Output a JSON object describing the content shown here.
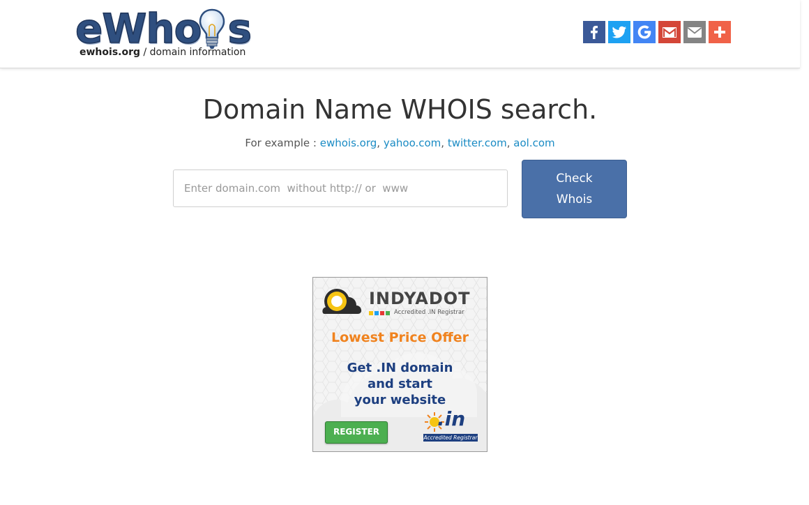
{
  "header": {
    "logo": {
      "main_text": "eWho",
      "main_text_tail": "s",
      "tag_bold": "ewhois.org",
      "tag_rest": " / domain information"
    },
    "share": [
      {
        "name": "facebook",
        "icon": "facebook-icon",
        "color": "#3b5998"
      },
      {
        "name": "twitter",
        "icon": "twitter-icon",
        "color": "#1da1f2"
      },
      {
        "name": "google",
        "icon": "google-icon",
        "color": "#4285f4"
      },
      {
        "name": "gmail",
        "icon": "gmail-icon",
        "color": "#d44638"
      },
      {
        "name": "email",
        "icon": "email-icon",
        "color": "#848484"
      },
      {
        "name": "more",
        "icon": "plus-icon",
        "color": "#f06248"
      }
    ]
  },
  "main": {
    "title": "Domain Name WHOIS search.",
    "examples_label": "For example : ",
    "examples": [
      "ewhois.org",
      "yahoo.com",
      "twitter.com",
      "aol.com"
    ],
    "search": {
      "placeholder": "Enter domain.com  without http:// or  www",
      "value": ""
    },
    "button_line1": "Check",
    "button_line2": "Whois"
  },
  "ad": {
    "brand": "INDYADOT",
    "brand_sub": "Accredited .IN Registrar",
    "headline": "Lowest Price Offer",
    "line1": "Get .IN domain",
    "line2": "and start",
    "line3": "your website",
    "register": "REGISTER",
    "badge_main": ".in",
    "badge_sub": "Accredited Registrar"
  },
  "colors": {
    "accent": "#4a70a8",
    "link": "#1a8bc4",
    "ad_orange": "#f0831f",
    "ad_navy": "#1d3f80",
    "ad_green": "#4caf50"
  }
}
